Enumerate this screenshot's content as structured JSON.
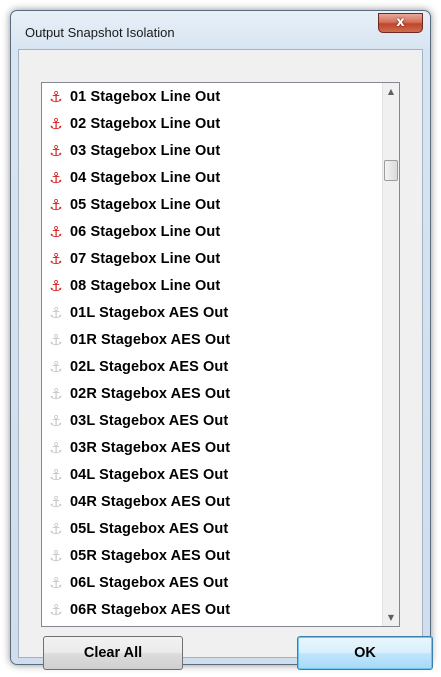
{
  "window": {
    "title": "Output Snapshot Isolation",
    "close_glyph": "x"
  },
  "list": {
    "items": [
      {
        "label": "01 Stagebox Line Out",
        "icon": "anchor-icon",
        "isolated": true
      },
      {
        "label": "02 Stagebox Line Out",
        "icon": "anchor-icon",
        "isolated": true
      },
      {
        "label": "03 Stagebox Line Out",
        "icon": "anchor-icon",
        "isolated": true
      },
      {
        "label": "04 Stagebox Line Out",
        "icon": "anchor-icon",
        "isolated": true
      },
      {
        "label": "05 Stagebox Line Out",
        "icon": "anchor-icon",
        "isolated": true
      },
      {
        "label": "06 Stagebox Line Out",
        "icon": "anchor-icon",
        "isolated": true
      },
      {
        "label": "07 Stagebox Line Out",
        "icon": "anchor-icon",
        "isolated": true
      },
      {
        "label": "08 Stagebox Line Out",
        "icon": "anchor-icon",
        "isolated": true
      },
      {
        "label": "01L Stagebox AES Out",
        "icon": "anchor-icon",
        "isolated": false
      },
      {
        "label": "01R Stagebox AES Out",
        "icon": "anchor-icon",
        "isolated": false
      },
      {
        "label": "02L Stagebox AES Out",
        "icon": "anchor-icon",
        "isolated": false
      },
      {
        "label": "02R Stagebox AES Out",
        "icon": "anchor-icon",
        "isolated": false
      },
      {
        "label": "03L Stagebox AES Out",
        "icon": "anchor-icon",
        "isolated": false
      },
      {
        "label": "03R Stagebox AES Out",
        "icon": "anchor-icon",
        "isolated": false
      },
      {
        "label": "04L Stagebox AES Out",
        "icon": "anchor-icon",
        "isolated": false
      },
      {
        "label": "04R Stagebox AES Out",
        "icon": "anchor-icon",
        "isolated": false
      },
      {
        "label": "05L Stagebox AES Out",
        "icon": "anchor-icon",
        "isolated": false
      },
      {
        "label": "05R Stagebox AES Out",
        "icon": "anchor-icon",
        "isolated": false
      },
      {
        "label": "06L Stagebox AES Out",
        "icon": "anchor-icon",
        "isolated": false
      },
      {
        "label": "06R Stagebox AES Out",
        "icon": "anchor-icon",
        "isolated": false
      }
    ]
  },
  "buttons": {
    "clear_all_label": "Clear All",
    "ok_label": "OK"
  },
  "colors": {
    "isolated_icon": "#d41c1c",
    "not_isolated_icon": "#c7c7c7",
    "ok_button_accent": "#3c7fb1"
  }
}
